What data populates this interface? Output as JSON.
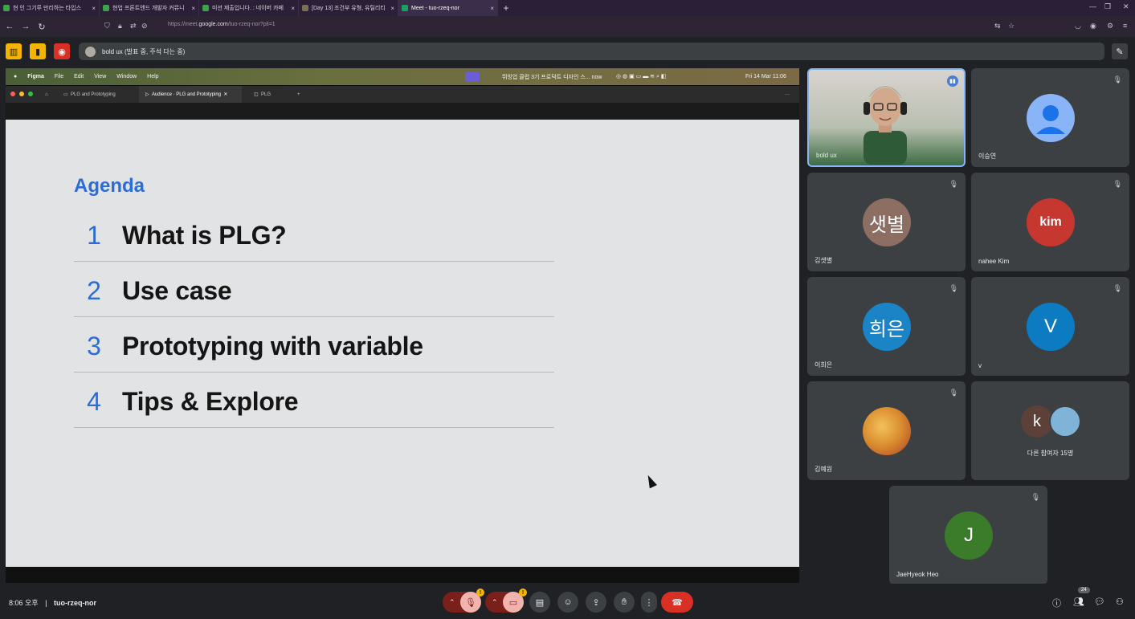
{
  "browser": {
    "tabs": [
      {
        "label": "현 인 그기루 만리하는 타입스",
        "color": "#3ea34a"
      },
      {
        "label": "현업 프론트엔드 개발자 커뮤니",
        "color": "#3ea34a"
      },
      {
        "label": "미션 제출입니다. : 네이버 카페",
        "color": "#3ea34a"
      },
      {
        "label": "[Day 13] 조건부 유형, 유틸리티",
        "color": "#7b6f57"
      },
      {
        "label": "Meet - tuo-rzeq-nor",
        "color": "#1aa260",
        "active": true
      }
    ],
    "new_tab": "+",
    "close_glyph": "×",
    "url_prefix": "https://meet.",
    "url_domain": "google.com",
    "url_path": "/tuo-rzeq-nor?pli=1"
  },
  "meet": {
    "presenting_label": "bold ux (발표 중, 주석 다는 중)",
    "meeting_code": "tuo-rzeq-nor",
    "time": "8:06 오후",
    "separator": "|",
    "participant_count": "24",
    "warning_badge": "!"
  },
  "figma": {
    "app": "Figma",
    "menus": [
      "File",
      "Edit",
      "View",
      "Window",
      "Help"
    ],
    "status_text": "뛰빙업 클럽 3기 프로덕트 디자인 스... now",
    "clock": "Fri 14 Mar  11:06",
    "tabs": [
      "PLG and Prototyping",
      "Audience · PLG and Prototyping",
      "PLG"
    ],
    "plus": "+",
    "more": "···"
  },
  "slide": {
    "title": "Agenda",
    "items": [
      {
        "num": "1",
        "text": "What is PLG?"
      },
      {
        "num": "2",
        "text": "Use case"
      },
      {
        "num": "3",
        "text": "Prototyping with variable"
      },
      {
        "num": "4",
        "text": "Tips & Explore"
      }
    ]
  },
  "participants": {
    "video": {
      "name": "bold ux"
    },
    "tiles": [
      {
        "name": "이승연",
        "initials": "",
        "color": "#8ab4f8"
      },
      {
        "name": "김샛별",
        "initials": "샛별",
        "color": "#8d6e63"
      },
      {
        "name": "nahee Kim",
        "initials": "kim",
        "color": "#c5372f"
      },
      {
        "name": "이희은",
        "initials": "희은",
        "color": "#1a84c6"
      },
      {
        "name": "v",
        "initials": "V",
        "color": "#0d7bc2"
      },
      {
        "name": "김예원",
        "initials": "",
        "color": "#d98a2d"
      },
      {
        "name": "다른 참여자 15명",
        "initials": "k",
        "color": "#5d4037"
      },
      {
        "name": "JaeHyeok Heo",
        "initials": "J",
        "color": "#3b7c2a"
      }
    ]
  }
}
